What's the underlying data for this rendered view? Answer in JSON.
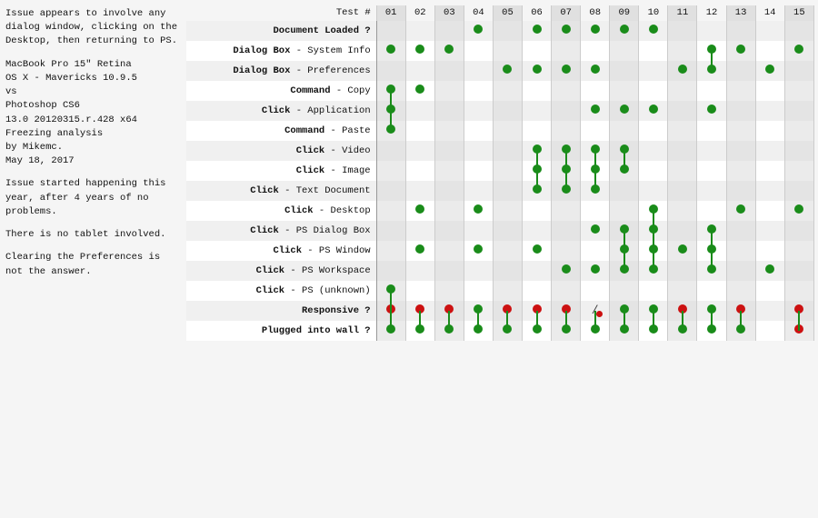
{
  "left": {
    "issue_desc": "Issue appears to involve any dialog window, clicking on the Desktop, then returning to PS.",
    "system_info": "MacBook Pro 15\" Retina\nOS X - Mavericks 10.9.5\nvs\nPhotoshop CS6\n13.0 20120315.r.428 x64\nFreezing analysis\nby Mikemc.\nMay 18, 2017",
    "issue_note": "Issue started happening this year, after 4 years of no problems.",
    "tablet_note": "There is no tablet involved.",
    "clearing_note": "Clearing the Preferences is not the answer."
  },
  "table": {
    "test_header": "Test #",
    "cols": [
      "01",
      "02",
      "03",
      "04",
      "05",
      "06",
      "07",
      "08",
      "09",
      "10",
      "11",
      "12",
      "13",
      "14",
      "15"
    ],
    "rows": [
      {
        "label": "Document Loaded ?",
        "bold": true,
        "dots": [
          0,
          0,
          0,
          1,
          0,
          1,
          1,
          1,
          1,
          1,
          0,
          0,
          0,
          0,
          0
        ]
      },
      {
        "label": "Dialog Box - System Info",
        "bold_prefix": "Dialog Box",
        "suffix": " - System Info",
        "dots": [
          1,
          1,
          1,
          0,
          0,
          0,
          0,
          0,
          0,
          0,
          0,
          1,
          1,
          0,
          1
        ]
      },
      {
        "label": "Dialog Box - Preferences",
        "bold_prefix": "Dialog Box",
        "suffix": " - Preferences",
        "dots": [
          0,
          0,
          0,
          0,
          1,
          1,
          1,
          1,
          0,
          0,
          1,
          1,
          0,
          1,
          0
        ]
      },
      {
        "label": "Command - Copy",
        "bold_prefix": "Command",
        "suffix": " - Copy",
        "dots": [
          1,
          1,
          0,
          0,
          0,
          0,
          0,
          0,
          0,
          0,
          0,
          0,
          0,
          0,
          0
        ]
      },
      {
        "label": "Click - Application",
        "bold_prefix": "Click",
        "suffix": " - Application",
        "dots": [
          1,
          0,
          0,
          0,
          0,
          0,
          0,
          1,
          1,
          1,
          0,
          1,
          0,
          0,
          0
        ]
      },
      {
        "label": "Command - Paste",
        "bold_prefix": "Command",
        "suffix": " - Paste",
        "dots": [
          1,
          0,
          0,
          0,
          0,
          0,
          0,
          0,
          0,
          0,
          0,
          0,
          0,
          0,
          0
        ]
      },
      {
        "label": "Click - Video",
        "bold_prefix": "Click",
        "suffix": " - Video",
        "dots": [
          0,
          0,
          0,
          0,
          0,
          1,
          1,
          1,
          1,
          0,
          0,
          0,
          0,
          0,
          0
        ]
      },
      {
        "label": "Click - Image",
        "bold_prefix": "Click",
        "suffix": " - Image",
        "dots": [
          0,
          0,
          0,
          0,
          0,
          1,
          1,
          1,
          1,
          0,
          0,
          0,
          0,
          0,
          0
        ]
      },
      {
        "label": "Click - Text Document",
        "bold_prefix": "Click",
        "suffix": " - Text Document",
        "dots": [
          0,
          0,
          0,
          0,
          0,
          1,
          1,
          1,
          0,
          0,
          0,
          0,
          0,
          0,
          0
        ]
      },
      {
        "label": "Click - Desktop",
        "bold_prefix": "Click",
        "suffix": " - Desktop",
        "dots": [
          0,
          1,
          0,
          1,
          0,
          0,
          0,
          0,
          0,
          1,
          0,
          0,
          1,
          0,
          1
        ]
      },
      {
        "label": "Click - PS Dialog Box",
        "bold_prefix": "Click",
        "suffix": " - PS Dialog Box",
        "dots": [
          0,
          0,
          0,
          0,
          0,
          0,
          0,
          1,
          1,
          1,
          0,
          1,
          0,
          0,
          0
        ]
      },
      {
        "label": "Click - PS Window",
        "bold_prefix": "Click",
        "suffix": " - PS Window",
        "dots": [
          0,
          1,
          0,
          1,
          0,
          1,
          0,
          0,
          1,
          1,
          1,
          1,
          0,
          0,
          0
        ]
      },
      {
        "label": "Click - PS Workspace",
        "bold_prefix": "Click",
        "suffix": " - PS Workspace",
        "dots": [
          0,
          0,
          0,
          0,
          0,
          0,
          1,
          1,
          1,
          1,
          0,
          1,
          0,
          1,
          0
        ]
      },
      {
        "label": "Click - PS (unknown)",
        "bold_prefix": "Click",
        "suffix": " - PS (unknown)",
        "dots": [
          1,
          0,
          0,
          0,
          0,
          0,
          0,
          0,
          0,
          0,
          0,
          0,
          0,
          0,
          0
        ]
      },
      {
        "label": "Responsive ?",
        "bold": true,
        "dots": [
          2,
          2,
          2,
          1,
          2,
          2,
          2,
          3,
          1,
          1,
          2,
          1,
          2,
          0,
          2
        ],
        "note": "col 8 is slash"
      },
      {
        "label": "Plugged into wall ?",
        "bold": true,
        "dots": [
          1,
          1,
          1,
          1,
          1,
          1,
          1,
          1,
          1,
          1,
          1,
          1,
          1,
          0,
          2
        ]
      }
    ]
  }
}
